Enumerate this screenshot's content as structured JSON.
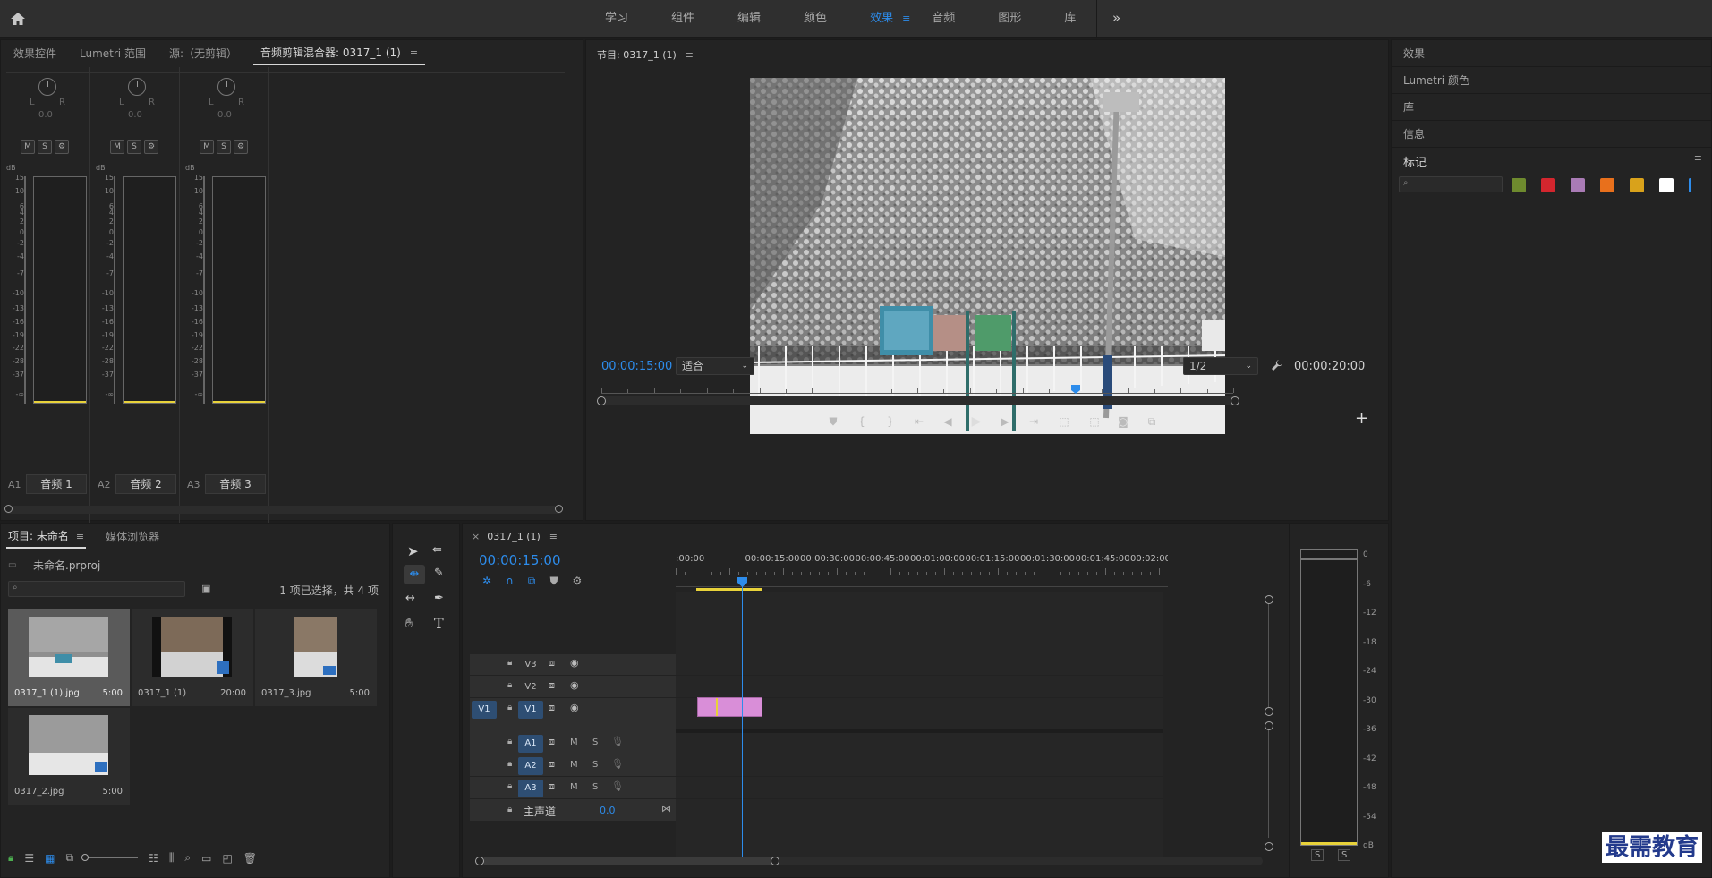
{
  "top_bar": {
    "home_label": "",
    "workspaces": [
      "学习",
      "组件",
      "编辑",
      "颜色",
      "效果",
      "音频",
      "图形",
      "库"
    ],
    "active_workspace": "效果",
    "more_label": "»"
  },
  "left_panel": {
    "tabs": [
      "效果控件",
      "Lumetri 范围",
      "源:（无剪辑）",
      "音频剪辑混合器: 0317_1 (1)"
    ],
    "active_tab": "音频剪辑混合器: 0317_1 (1)",
    "channels": [
      {
        "id": "A1",
        "name": "音频 1",
        "pan": "0.0"
      },
      {
        "id": "A2",
        "name": "音频 2",
        "pan": "0.0"
      },
      {
        "id": "A3",
        "name": "音频 3",
        "pan": "0.0"
      }
    ],
    "lr_label_l": "L",
    "lr_label_r": "R",
    "msr": [
      "M",
      "S",
      "⚙"
    ],
    "db_label": "dB",
    "db_scale": [
      "15",
      "10",
      "6",
      "4",
      "2",
      "0",
      "-2",
      "-4",
      "-7",
      "-10",
      "-13",
      "-16",
      "-19",
      "-22",
      "-28",
      "-37",
      "-∞"
    ]
  },
  "program_monitor": {
    "title": "节目: 0317_1 (1)",
    "current_time": "00:00:15:00",
    "fit": "适合",
    "resolution": "1/2",
    "duration": "00:00:20:00",
    "playhead_fraction": 0.75
  },
  "right_panel": {
    "items": [
      "效果",
      "Lumetri 颜色",
      "库",
      "信息"
    ],
    "markers_title": "标记",
    "marker_colors": [
      "#6e8a2e",
      "#d3262e",
      "#a97bb5",
      "#e8701c",
      "#d9a21b",
      "#ffffff",
      "#2d8ceb"
    ]
  },
  "project_panel": {
    "tabs": [
      "项目: 未命名",
      "媒体浏览器"
    ],
    "active_tab": "项目: 未命名",
    "project_file": "未命名.prproj",
    "selection_info": "1 项已选择，共 4 项",
    "items": [
      {
        "name": "0317_1 (1).jpg",
        "duration": "5:00"
      },
      {
        "name": "0317_1 (1)",
        "duration": "20:00"
      },
      {
        "name": "0317_3.jpg",
        "duration": "5:00"
      },
      {
        "name": "0317_2.jpg",
        "duration": "5:00"
      }
    ]
  },
  "timeline": {
    "title": "0317_1 (1)",
    "current_time": "00:00:15:00",
    "ruler": [
      ":00:00",
      "00:00:15:00",
      "00:00:30:00",
      "00:00:45:00",
      "00:01:00:00",
      "00:01:15:00",
      "00:01:30:00",
      "00:01:45:00",
      "00:02:00:00",
      "00"
    ],
    "video_tracks": [
      "V3",
      "V2",
      "V1"
    ],
    "audio_tracks": [
      "A1",
      "A2",
      "A3"
    ],
    "source_patch": "V1",
    "master_label": "主声道",
    "master_value": "0.0",
    "m_label": "M",
    "s_label": "S"
  },
  "audio_meter": {
    "scale": [
      "0",
      "-6",
      "-12",
      "-18",
      "-24",
      "-30",
      "-36",
      "-42",
      "-48",
      "-54",
      "dB"
    ],
    "solo_labels": [
      "S",
      "S"
    ]
  },
  "watermark": "最需教育"
}
